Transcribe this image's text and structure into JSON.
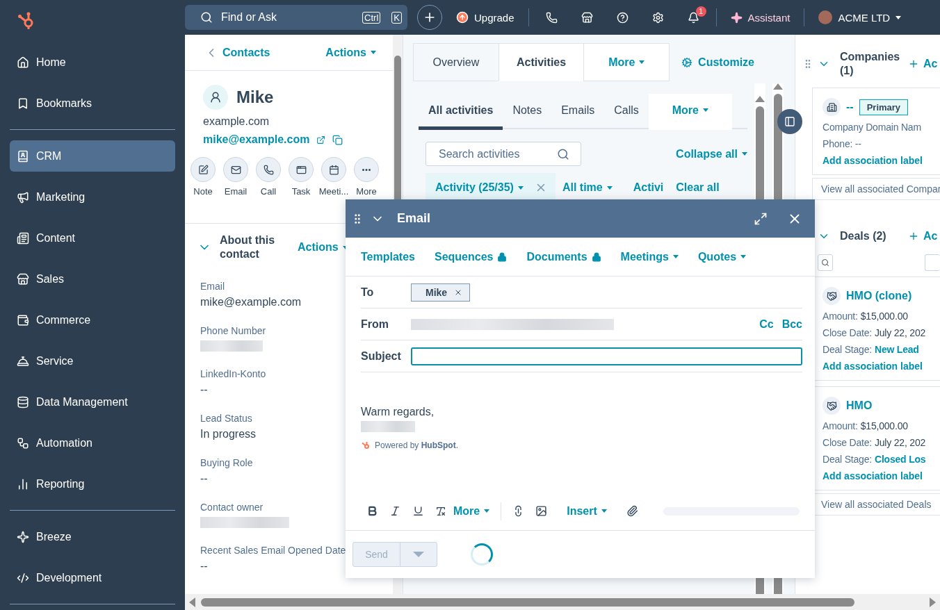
{
  "sidebar": {
    "sections": [
      {
        "items": [
          {
            "label": "Home",
            "selected": false
          },
          {
            "label": "Bookmarks",
            "selected": false
          }
        ]
      },
      {
        "items": [
          {
            "label": "CRM",
            "selected": true
          },
          {
            "label": "Marketing",
            "selected": false
          },
          {
            "label": "Content",
            "selected": false
          },
          {
            "label": "Sales",
            "selected": false
          },
          {
            "label": "Commerce",
            "selected": false
          },
          {
            "label": "Service",
            "selected": false
          },
          {
            "label": "Data Management",
            "selected": false
          },
          {
            "label": "Automation",
            "selected": false
          },
          {
            "label": "Reporting",
            "selected": false
          }
        ]
      },
      {
        "items": [
          {
            "label": "Breeze",
            "selected": false
          },
          {
            "label": "Development",
            "selected": false
          }
        ]
      }
    ]
  },
  "topbar": {
    "search_placeholder": "Find or Ask",
    "shortcut": [
      "Ctrl",
      "K"
    ],
    "upgrade": "Upgrade",
    "notification_count": "1",
    "assistant": "Assistant",
    "account": "ACME LTD"
  },
  "contact": {
    "back": "Contacts",
    "actions": "Actions",
    "name": "Mike",
    "domain": "example.com",
    "email": "mike@example.com",
    "quick_actions": [
      "Note",
      "Email",
      "Call",
      "Task",
      "Meeti...",
      "More"
    ],
    "about": {
      "title": "About this contact",
      "actions": "Actions",
      "expanded": true,
      "fields": [
        {
          "label": "Email",
          "kind": "text",
          "value": "mike@example.com"
        },
        {
          "label": "Phone Number",
          "kind": "redacted"
        },
        {
          "label": "LinkedIn-Konto",
          "kind": "text",
          "value": "--"
        },
        {
          "label": "Lead Status",
          "kind": "text",
          "value": "In progress"
        },
        {
          "label": "Buying Role",
          "kind": "text",
          "value": "--"
        },
        {
          "label": "Contact owner",
          "kind": "redacted"
        },
        {
          "label": "Recent Sales Email Opened Date",
          "kind": "text",
          "value": "--"
        }
      ]
    }
  },
  "record_tabs": [
    {
      "label": "Overview",
      "selected": false,
      "kind": "tab"
    },
    {
      "label": "Activities",
      "selected": true,
      "kind": "tab"
    },
    {
      "label": "More",
      "selected": false,
      "kind": "menu"
    }
  ],
  "customize": "Customize",
  "activity_tabs": [
    {
      "label": "All activities",
      "selected": true,
      "kind": "tab"
    },
    {
      "label": "Notes",
      "selected": false,
      "kind": "tab"
    },
    {
      "label": "Emails",
      "selected": false,
      "kind": "tab"
    },
    {
      "label": "Calls",
      "selected": false,
      "kind": "tab"
    },
    {
      "label": "More",
      "selected": false,
      "kind": "menu"
    }
  ],
  "activity_search_placeholder": "Search activities",
  "collapse_all": "Collapse all",
  "filters": [
    {
      "label": "Activity (25/35)",
      "kind": "chip"
    },
    {
      "label": "All time",
      "kind": "menu"
    },
    {
      "label": "Activi",
      "kind": "plain"
    }
  ],
  "clear_all": "Clear all",
  "email_composer": {
    "title": "Email",
    "toolbar": [
      {
        "label": "Templates",
        "kind": "plain"
      },
      {
        "label": "Sequences",
        "kind": "locked"
      },
      {
        "label": "Documents",
        "kind": "locked"
      },
      {
        "label": "Meetings",
        "kind": "menu"
      },
      {
        "label": "Quotes",
        "kind": "menu"
      }
    ],
    "to_label": "To",
    "recipients": [
      "Mike"
    ],
    "from_label": "From",
    "cc": "Cc",
    "bcc": "Bcc",
    "subject_label": "Subject",
    "body": "Warm regards,",
    "powered_by": "Powered by **HubSpot**.",
    "format_more": "More",
    "insert": "Insert",
    "send": {
      "label": "Send",
      "disabled": true
    }
  },
  "associations": [
    {
      "title": "Companies (1)",
      "add": "Ac",
      "expanded": true,
      "cards": [
        {
          "name": "--",
          "badge": "Primary",
          "kind": "company",
          "lines": [
            {
              "label": "Company Domain Nam",
              "kind": "text"
            },
            {
              "label": "Phone: --",
              "kind": "text"
            }
          ],
          "add_label": "Add association label"
        }
      ],
      "view_all": "View all associated Compar"
    },
    {
      "title": "Deals (2)",
      "add": "Ac",
      "expanded": true,
      "cards": [
        {
          "name": "HMO (clone)",
          "kind": "deal",
          "lines": [
            {
              "label": "Amount:",
              "value": "$15,000.00",
              "kind": "text"
            },
            {
              "label": "Close Date:",
              "value": "July 22, 202",
              "kind": "text"
            },
            {
              "label": "Deal Stage:",
              "value": "New Lead",
              "kind": "link"
            }
          ],
          "add_label": "Add association label"
        },
        {
          "name": "HMO",
          "kind": "deal",
          "lines": [
            {
              "label": "Amount:",
              "value": "$15,000.00",
              "kind": "text"
            },
            {
              "label": "Close Date:",
              "value": "July 22, 202",
              "kind": "text"
            },
            {
              "label": "Deal Stage:",
              "value": "Closed Los",
              "kind": "link"
            }
          ],
          "add_label": "Add association label"
        }
      ],
      "view_all": "View all associated Deals"
    }
  ]
}
